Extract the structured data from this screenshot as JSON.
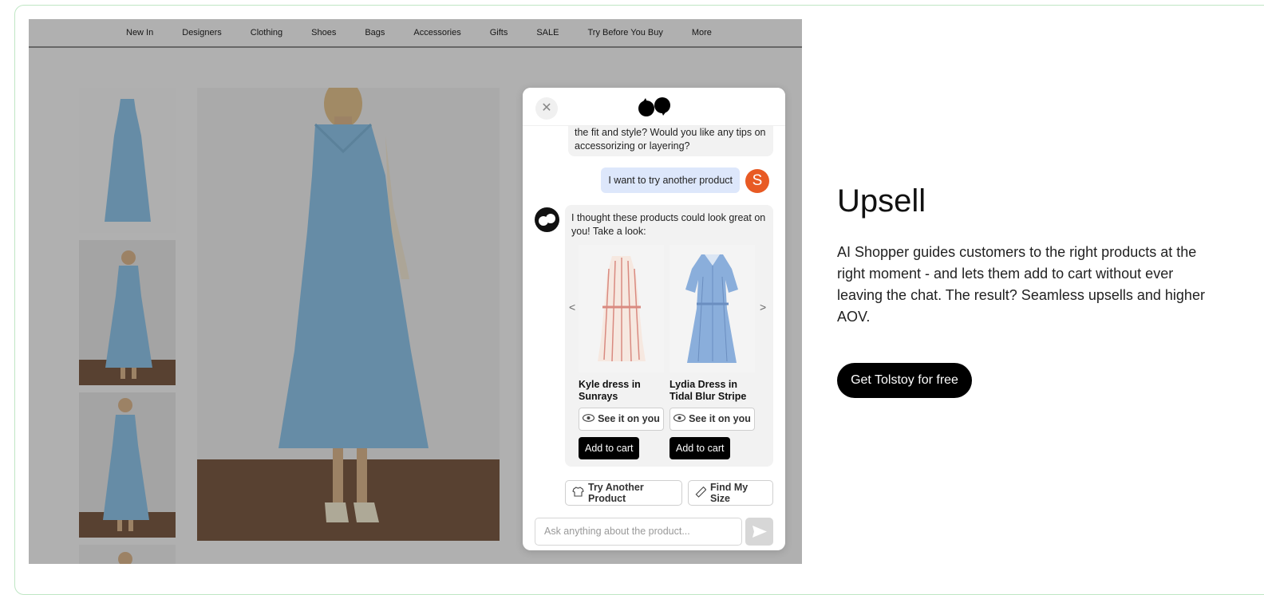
{
  "nav": [
    "New In",
    "Designers",
    "Clothing",
    "Shoes",
    "Bags",
    "Accessories",
    "Gifts",
    "SALE",
    "Try Before You Buy",
    "More"
  ],
  "chat": {
    "prev_message_tail": "the fit and style? Would you like any tips on accessorizing or layering?",
    "user_message": "I want to try another product",
    "user_initial": "S",
    "bot_message": "I thought these products could look great on you! Take a look:",
    "products": [
      {
        "name": "Kyle dress in Sunrays",
        "see_label": "See it on you",
        "cart_label": "Add to cart"
      },
      {
        "name": "Lydia Dress in Tidal Blur Stripe",
        "see_label": "See it on you",
        "cart_label": "Add to cart"
      }
    ],
    "prev_arrow": "<",
    "next_arrow": ">",
    "chips": [
      "Try Another Product",
      "Find My Size"
    ],
    "input_placeholder": "Ask anything about the product..."
  },
  "side": {
    "title": "Upsell",
    "description": "AI Shopper guides customers to the right products at the right moment - and lets them add to cart without ever leaving the chat. The result? Seamless upsells and higher AOV.",
    "cta": "Get Tolstoy for free"
  },
  "colors": {
    "accent": "#000000",
    "user_bubble": "#dde7fb",
    "avatar": "#e85a24",
    "dress": "#8ec3e6"
  }
}
